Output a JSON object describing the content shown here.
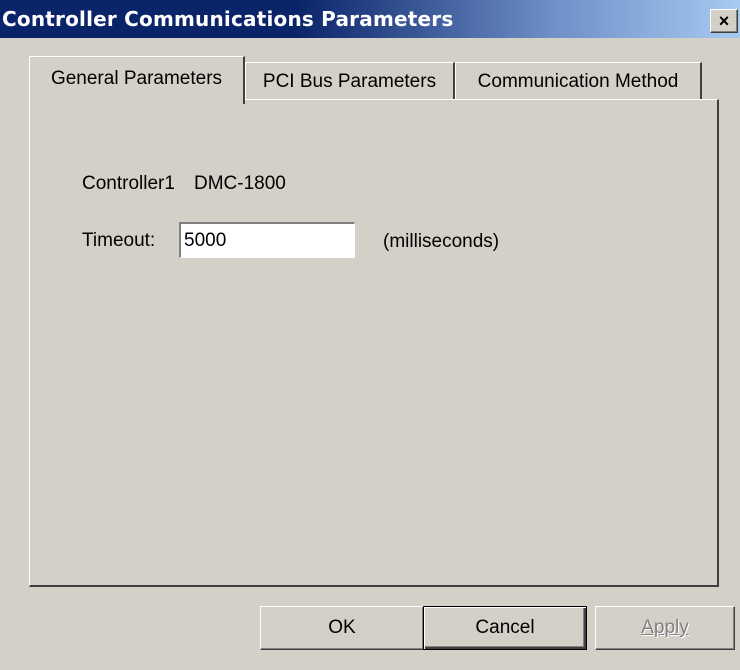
{
  "window": {
    "title": "Controller Communications Parameters",
    "close_glyph": "×"
  },
  "tabs": [
    {
      "label": "General Parameters",
      "active": true
    },
    {
      "label": "PCI Bus Parameters",
      "active": false
    },
    {
      "label": "Communication Method",
      "active": false
    }
  ],
  "general": {
    "controller_name": "Controller1",
    "controller_model": "DMC-1800",
    "timeout_label": "Timeout:",
    "timeout_value": "5000",
    "timeout_units": "(milliseconds)"
  },
  "buttons": {
    "ok": "OK",
    "cancel": "Cancel",
    "apply": "Apply"
  },
  "icons": {
    "close": "close-icon"
  }
}
